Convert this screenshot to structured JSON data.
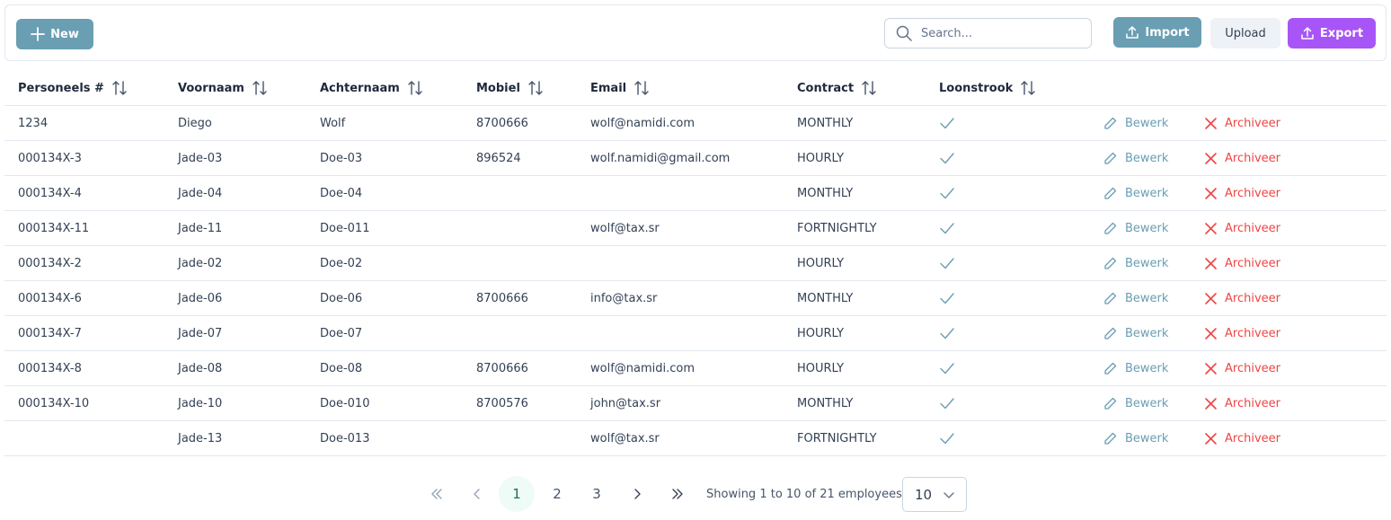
{
  "toolbar": {
    "new_label": "New",
    "search_placeholder": "Search...",
    "import_label": "Import",
    "upload_label": "Upload",
    "export_label": "Export"
  },
  "colors": {
    "primary": "#6a9eb3",
    "export": "#a855f7",
    "danger": "#ef4444",
    "active_page_bg": "#eefbf6"
  },
  "table": {
    "columns": [
      "Personeels #",
      "Voornaam",
      "Achternaam",
      "Mobiel",
      "Email",
      "Contract",
      "Loonstrook"
    ],
    "edit_label": "Bewerk",
    "archive_label": "Archiveer",
    "rows": [
      {
        "id": "1234",
        "first": "Diego",
        "last": "Wolf",
        "mobile": "8700666",
        "email": "wolf@namidi.com",
        "contract": "MONTHLY",
        "payslip": true
      },
      {
        "id": "000134X-3",
        "first": "Jade-03",
        "last": "Doe-03",
        "mobile": "896524",
        "email": "wolf.namidi@gmail.com",
        "contract": "HOURLY",
        "payslip": true
      },
      {
        "id": "000134X-4",
        "first": "Jade-04",
        "last": "Doe-04",
        "mobile": "",
        "email": "",
        "contract": "MONTHLY",
        "payslip": true
      },
      {
        "id": "000134X-11",
        "first": "Jade-11",
        "last": "Doe-011",
        "mobile": "",
        "email": "wolf@tax.sr",
        "contract": "FORTNIGHTLY",
        "payslip": true
      },
      {
        "id": "000134X-2",
        "first": "Jade-02",
        "last": "Doe-02",
        "mobile": "",
        "email": "",
        "contract": "HOURLY",
        "payslip": true
      },
      {
        "id": "000134X-6",
        "first": "Jade-06",
        "last": "Doe-06",
        "mobile": "8700666",
        "email": "info@tax.sr",
        "contract": "MONTHLY",
        "payslip": true
      },
      {
        "id": "000134X-7",
        "first": "Jade-07",
        "last": "Doe-07",
        "mobile": "",
        "email": "",
        "contract": "HOURLY",
        "payslip": true
      },
      {
        "id": "000134X-8",
        "first": "Jade-08",
        "last": "Doe-08",
        "mobile": "8700666",
        "email": "wolf@namidi.com",
        "contract": "HOURLY",
        "payslip": true
      },
      {
        "id": "000134X-10",
        "first": "Jade-10",
        "last": "Doe-010",
        "mobile": "8700576",
        "email": "john@tax.sr",
        "contract": "MONTHLY",
        "payslip": true
      },
      {
        "id": "",
        "first": "Jade-13",
        "last": "Doe-013",
        "mobile": "",
        "email": "wolf@tax.sr",
        "contract": "FORTNIGHTLY",
        "payslip": true
      }
    ]
  },
  "pagination": {
    "pages": [
      "1",
      "2",
      "3"
    ],
    "current_page": "1",
    "info": "Showing 1 to 10 of 21 employees",
    "page_size": "10"
  }
}
